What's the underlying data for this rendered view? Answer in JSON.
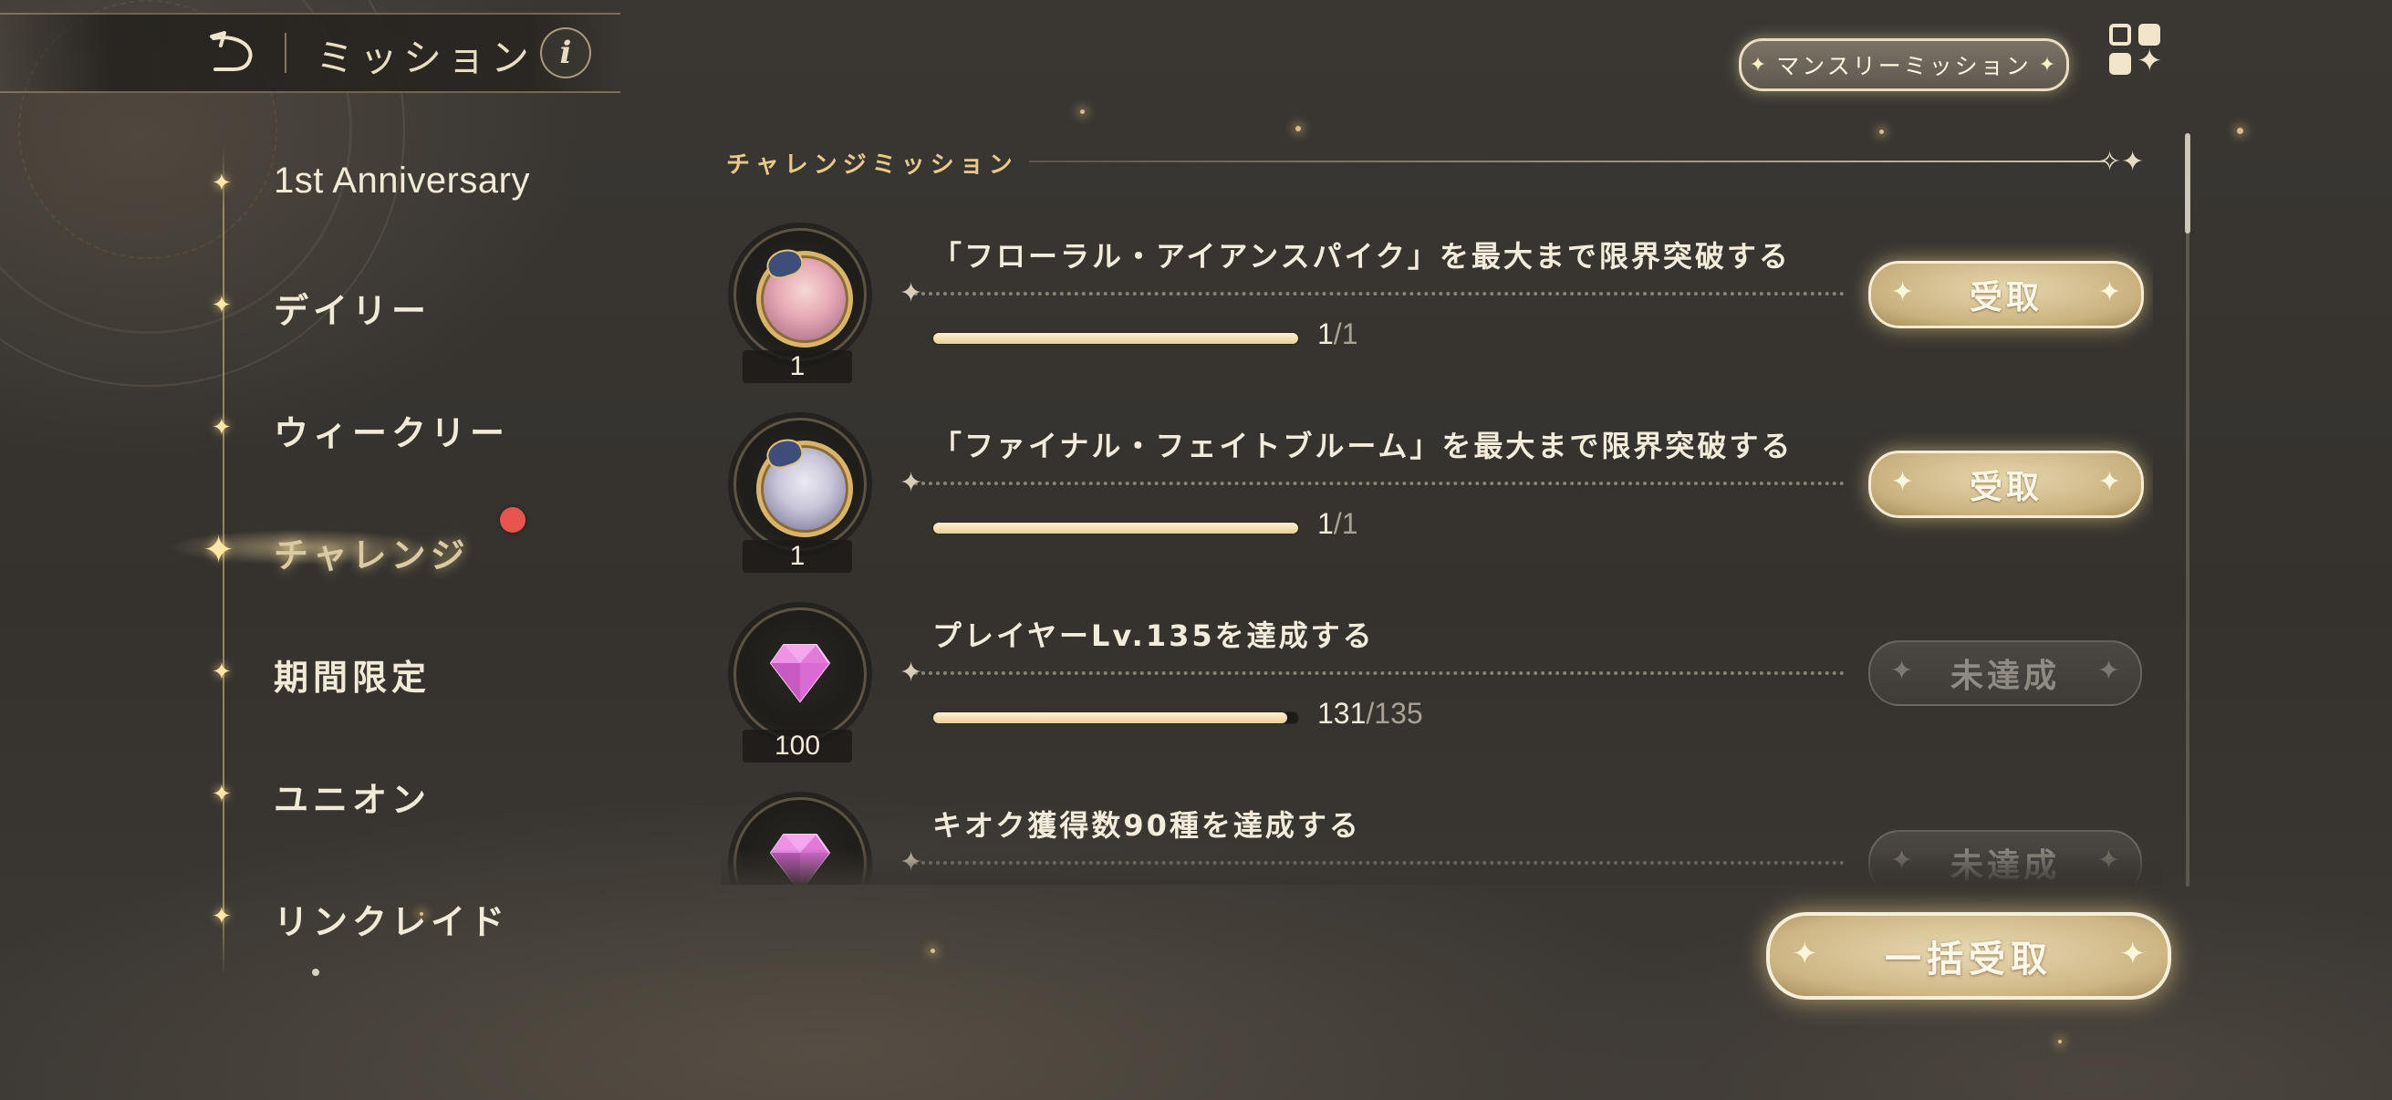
{
  "header": {
    "title": "ミッション",
    "info_label": "i"
  },
  "top_right": {
    "monthly_mission_label": "マンスリーミッション"
  },
  "sidebar": {
    "items": [
      {
        "label": "1st Anniversary",
        "active": false
      },
      {
        "label": "デイリー",
        "active": false
      },
      {
        "label": "ウィークリー",
        "active": false
      },
      {
        "label": "チャレンジ",
        "active": true,
        "has_badge": true
      },
      {
        "label": "期間限定",
        "active": false
      },
      {
        "label": "ユニオン",
        "active": false
      },
      {
        "label": "リンクレイド",
        "active": false
      }
    ]
  },
  "section": {
    "title": "チャレンジミッション"
  },
  "missions": [
    {
      "text": "「フローラル・アイアンスパイク」を最大まで限界突破する",
      "reward_type": "character-portrait",
      "reward_count": "1",
      "progress_current": "1",
      "progress_total": "/1",
      "progress_fraction": 1.0,
      "status": "claimable",
      "button_label": "受取"
    },
    {
      "text": "「ファイナル・フェイトブルーム」を最大まで限界突破する",
      "reward_type": "character-portrait",
      "reward_count": "1",
      "progress_current": "1",
      "progress_total": "/1",
      "progress_fraction": 1.0,
      "status": "claimable",
      "button_label": "受取"
    },
    {
      "text": "プレイヤーLv.135を達成する",
      "reward_type": "gem-icon",
      "reward_count": "100",
      "progress_current": "131",
      "progress_total": "/135",
      "progress_fraction": 0.97,
      "status": "incomplete",
      "button_label": "未達成"
    },
    {
      "text": "キオク獲得数90種を達成する",
      "reward_type": "gem-icon",
      "reward_count": "",
      "progress_current": "",
      "progress_total": "",
      "progress_fraction": 0.0,
      "status": "incomplete",
      "button_label": "未達成"
    }
  ],
  "footer": {
    "claim_all_label": "一括受取"
  },
  "colors": {
    "background": "#37342f",
    "accent_gold": "#e9c98a",
    "button_gold": "#cdb684",
    "badge_red": "#e8554f",
    "progress_fill": "#f1deb0"
  }
}
